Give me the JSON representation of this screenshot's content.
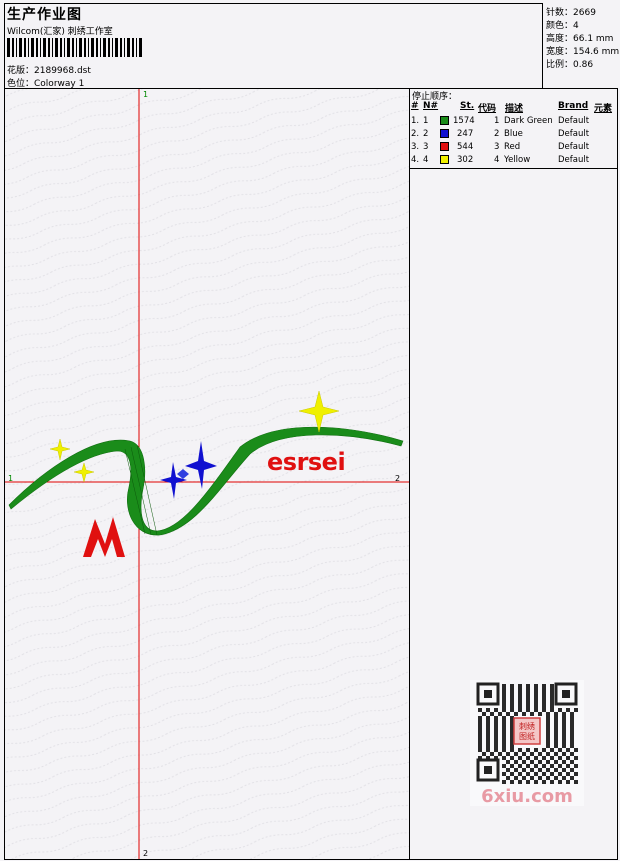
{
  "header": {
    "title": "生产作业图",
    "company": "Wilcom(汇家) 刺绣工作室",
    "design_label": "花版：",
    "design_file": "2189968.dst",
    "colorway_label": "色位：",
    "colorway": "Colorway 1"
  },
  "stats": [
    {
      "label": "针数：",
      "value": "2669"
    },
    {
      "label": "颜色：",
      "value": "4"
    },
    {
      "label": "高度：",
      "value": "66.1 mm"
    },
    {
      "label": "宽度：",
      "value": "154.6 mm"
    },
    {
      "label": "比例：",
      "value": "0.86"
    }
  ],
  "stop_sequence": {
    "heading": "停止顺序：",
    "columns": {
      "num": "#",
      "no": "N#",
      "st": "St.",
      "code": "代码",
      "desc": "描述",
      "brand": "Brand",
      "element": "元素"
    },
    "rows": [
      {
        "num": "1.",
        "no": "1",
        "color": "#1a8c1a",
        "st": "1574",
        "code": "1",
        "desc": "Dark Green",
        "brand": "Default"
      },
      {
        "num": "2.",
        "no": "2",
        "color": "#1010d0",
        "st": "247",
        "code": "2",
        "desc": "Blue",
        "brand": "Default"
      },
      {
        "num": "3.",
        "no": "3",
        "color": "#e01010",
        "st": "544",
        "code": "3",
        "desc": "Red",
        "brand": "Default"
      },
      {
        "num": "4.",
        "no": "4",
        "color": "#f0f000",
        "st": "302",
        "code": "4",
        "desc": "Yellow",
        "brand": "Default"
      }
    ]
  },
  "canvas": {
    "axis_top": "1",
    "axis_bottom": "2",
    "axis_left": "1",
    "axis_right": "2",
    "design_text": "esrsei"
  },
  "watermark": {
    "stamp": "刺绣图纸",
    "site": "6xiu.com"
  },
  "colors": {
    "green": "#1a8c1a",
    "blue": "#1010d0",
    "red": "#e01010",
    "yellow": "#f0f000",
    "axis": "#e00000"
  }
}
